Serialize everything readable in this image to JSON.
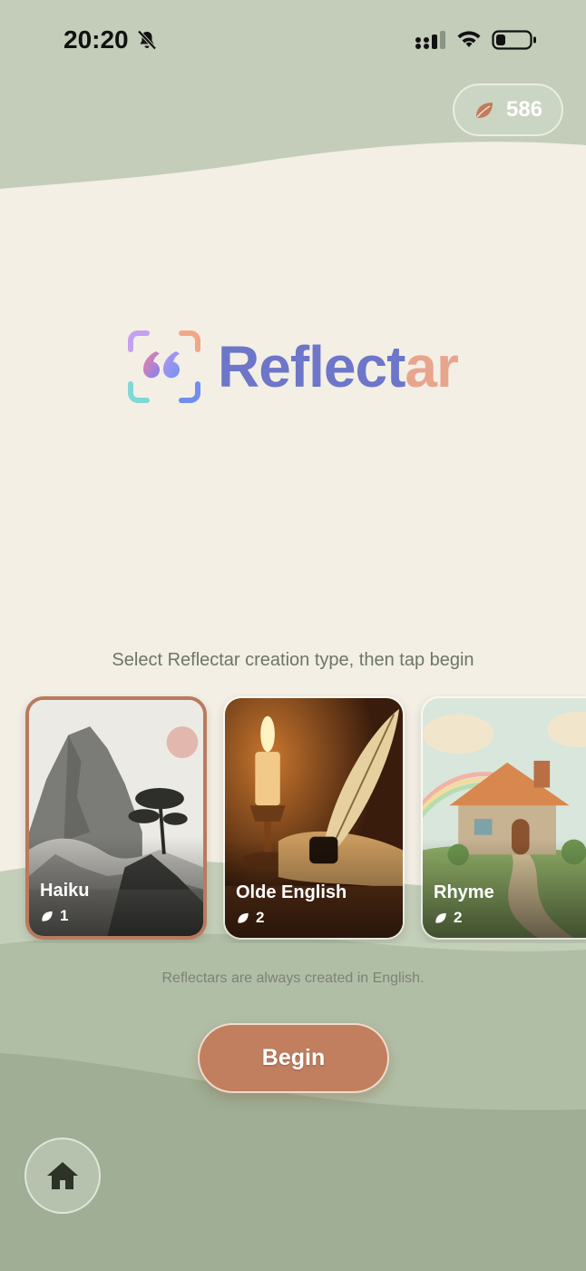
{
  "status_bar": {
    "time": "20:20"
  },
  "balance": {
    "count": "586",
    "icon": "leaf-icon"
  },
  "logo": {
    "word_part1": "Reflect",
    "word_part2": "ar"
  },
  "instruction": "Select Reflectar creation type, then tap begin",
  "cards": [
    {
      "title": "Haiku",
      "cost": "1",
      "selected": true
    },
    {
      "title": "Olde English",
      "cost": "2",
      "selected": false
    },
    {
      "title": "Rhyme",
      "cost": "2",
      "selected": false
    }
  ],
  "note": "Reflectars are always created in English.",
  "begin_label": "Begin",
  "colors": {
    "accent": "#c17f60",
    "sage": "#b6c2ad",
    "cream": "#f3efe5",
    "logo_blue": "#6d76c8",
    "logo_peach": "#e8a58e"
  }
}
